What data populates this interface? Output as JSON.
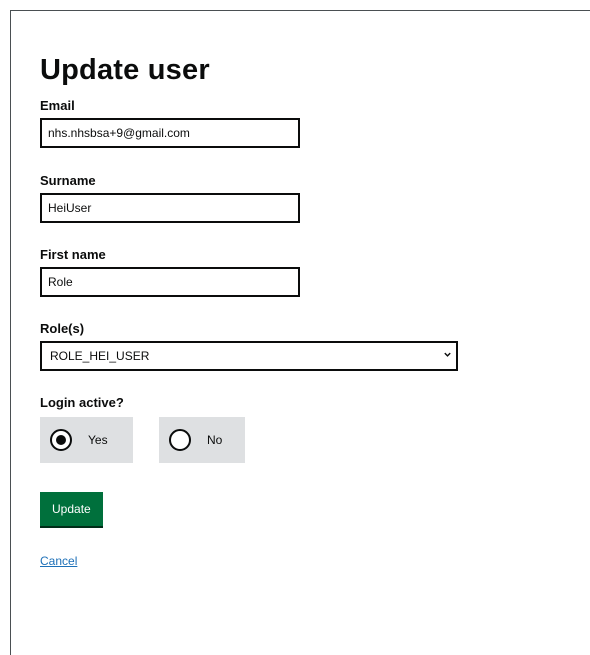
{
  "page": {
    "title": "Update user"
  },
  "form": {
    "email": {
      "label": "Email",
      "value": "nhs.nhsbsa+9@gmail.com"
    },
    "surname": {
      "label": "Surname",
      "value": "HeiUser"
    },
    "first_name": {
      "label": "First name",
      "value": "Role"
    },
    "roles": {
      "label": "Role(s)",
      "selected": "ROLE_HEI_USER"
    },
    "login_active": {
      "label": "Login active?",
      "options": [
        {
          "label": "Yes",
          "checked": true
        },
        {
          "label": "No",
          "checked": false
        }
      ]
    },
    "submit_label": "Update",
    "cancel_label": "Cancel"
  },
  "colors": {
    "button": "#00703c",
    "link": "#1d70b8",
    "radio_background": "#dee0e2"
  },
  "icons": {
    "select_chevron": "chevron-down-icon"
  }
}
